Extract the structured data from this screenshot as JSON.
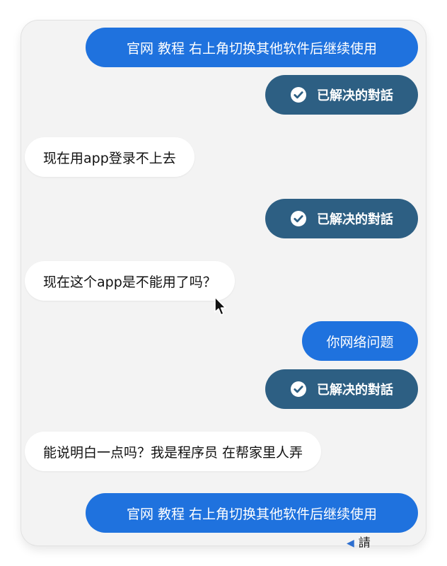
{
  "chat": {
    "messages": [
      {
        "side": "out",
        "text": "官网 教程 右上角切换其他软件后继续使用"
      },
      {
        "side": "status",
        "text": "已解决的對話"
      },
      {
        "side": "in",
        "text": "现在用app登录不上去"
      },
      {
        "side": "status",
        "text": "已解决的對話"
      },
      {
        "side": "in",
        "text": "现在这个app是不能用了吗？"
      },
      {
        "side": "out",
        "text": "你网络问题"
      },
      {
        "side": "status",
        "text": "已解决的對話"
      },
      {
        "side": "in",
        "text": "能说明白一点吗？我是程序员 在帮家里人弄"
      },
      {
        "side": "out",
        "text": "官网 教程 右上角切换其他软件后继续使用"
      }
    ],
    "footer_peek": "請"
  },
  "colors": {
    "outgoing_bubble": "#1f72de",
    "resolved_bubble": "#2d5f83",
    "incoming_bubble": "#ffffff",
    "background": "#f3f3f3"
  },
  "icons": {
    "resolved": "check-circle-icon",
    "pointer": "mouse-cursor-icon"
  }
}
